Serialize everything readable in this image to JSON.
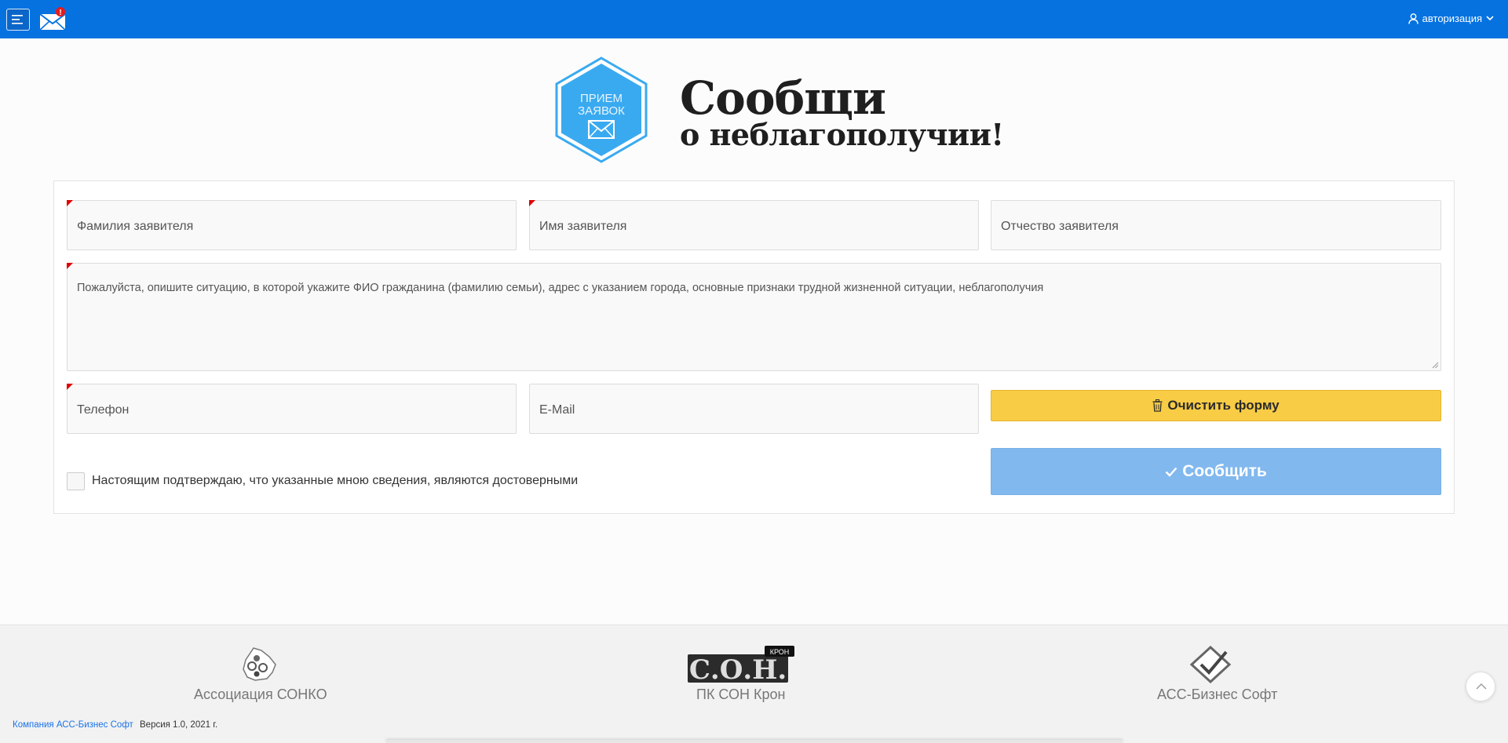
{
  "header": {
    "auth_label": "авторизация",
    "notification_badge": "!"
  },
  "hero": {
    "logo_line1": "ПРИЕМ",
    "logo_line2": "ЗАЯВОК",
    "title_line1": "Сообщи",
    "title_line2": "о неблагополучии!"
  },
  "form": {
    "surname_placeholder": "Фамилия заявителя",
    "name_placeholder": "Имя заявителя",
    "patronymic_placeholder": "Отчество заявителя",
    "description_placeholder": "Пожалуйста, опишите ситуацию, в которой укажите ФИО гражданина (фамилию семьи), адрес с указанием города, основные признаки трудной жизненной ситуации, неблагополучия",
    "phone_placeholder": "Телефон",
    "email_placeholder": "E-Mail",
    "clear_button": "Очистить форму",
    "submit_button": "Сообщить",
    "confirm_label": "Настоящим подтверждаю, что указанные мною сведения, являются достоверными"
  },
  "footer": {
    "partner1": "Ассоциация СОНКО",
    "partner2": "ПК СОН Крон",
    "partner2_logo_text": "С.О.Н.",
    "partner2_logo_badge": "КРОН",
    "partner3": "АСС-Бизнес Софт",
    "company_link": "Компания АСС-Бизнес Софт",
    "version": "Версия 1.0, 2021 г."
  },
  "colors": {
    "header_bg": "#0572e0",
    "accent_yellow": "#f8cc45",
    "submit_blue": "#81b8ee",
    "required_marker": "#e00000"
  },
  "icons": [
    "hamburger-menu-icon",
    "envelope-icon",
    "user-icon",
    "chevron-down-icon",
    "trash-icon",
    "check-icon",
    "chevron-up-icon"
  ]
}
